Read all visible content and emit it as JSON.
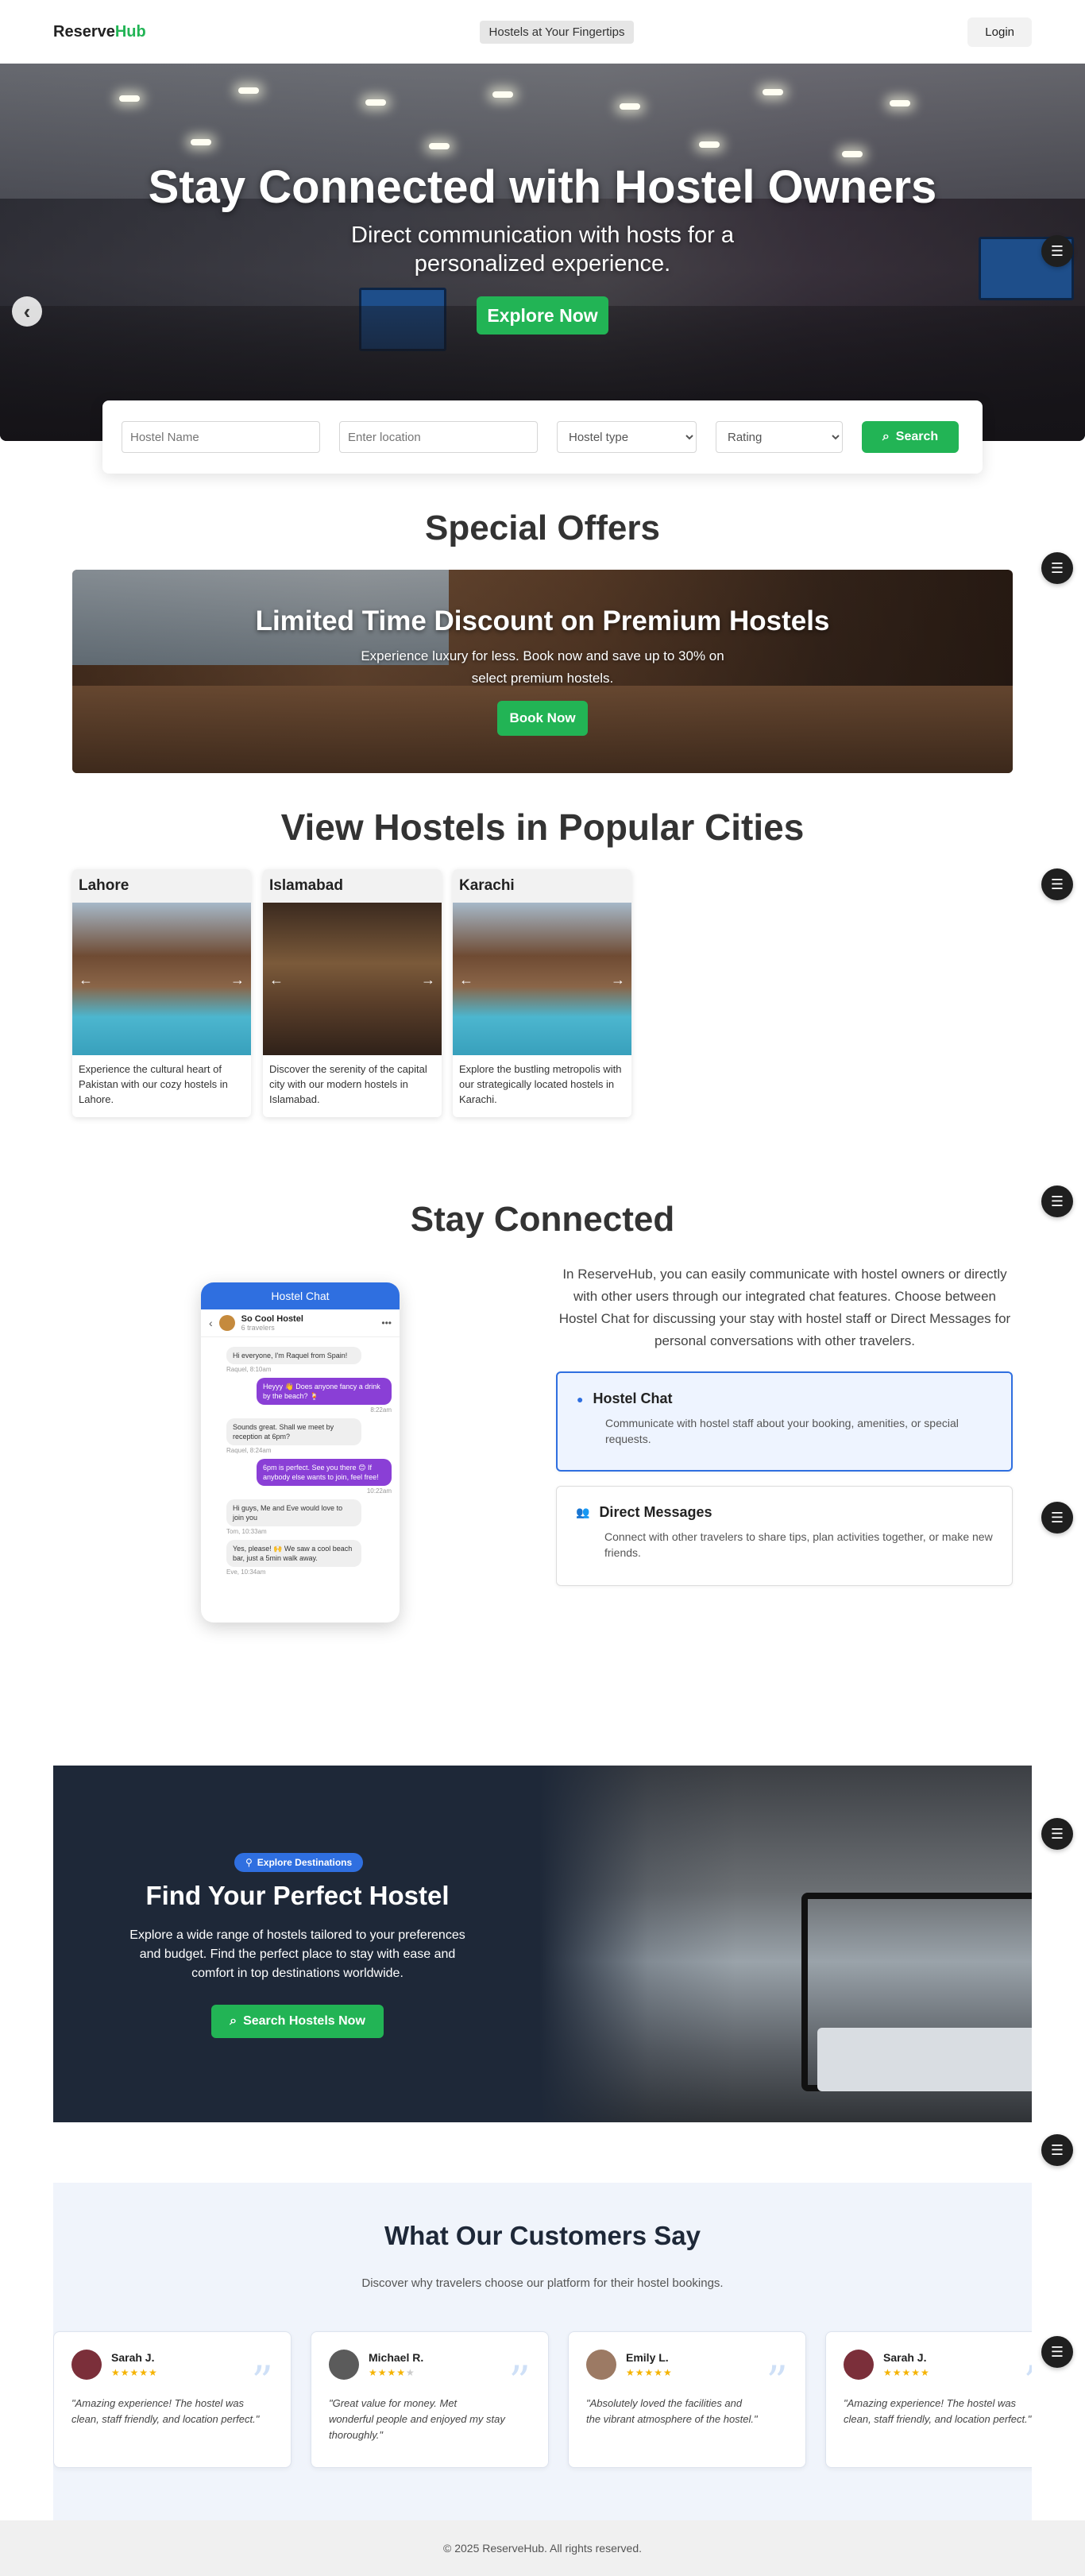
{
  "nav": {
    "brand_primary": "Reserve",
    "brand_accent": "Hub",
    "tagline": "Hostels at Your Fingertips",
    "login": "Login"
  },
  "hero": {
    "title": "Stay Connected with Hostel Owners",
    "subtitle": "Direct communication with hosts for a personalized experience.",
    "cta": "Explore Now",
    "prev_icon": "chevron-left-icon"
  },
  "search": {
    "name_placeholder": "Hostel Name",
    "location_placeholder": "Enter location",
    "type_selected": "Hostel type",
    "rating_selected": "Rating",
    "button": "Search"
  },
  "offers": {
    "section_title": "Special Offers",
    "title": "Limited Time Discount on Premium Hostels",
    "text": "Experience luxury for less. Book now and save up to 30% on select premium hostels.",
    "cta": "Book Now"
  },
  "cities": {
    "section_title": "View Hostels in Popular Cities",
    "items": [
      {
        "name": "Lahore",
        "desc": "Experience the cultural heart of Pakistan with our cozy hostels in Lahore."
      },
      {
        "name": "Islamabad",
        "desc": "Discover the serenity of the capital city with our modern hostels in Islamabad."
      },
      {
        "name": "Karachi",
        "desc": "Explore the bustling metropolis with our strategically located hostels in Karachi."
      }
    ]
  },
  "connected": {
    "section_title": "Stay Connected",
    "text": "In ReserveHub, you can easily communicate with hostel owners or directly with other users through our integrated chat features. Choose between Hostel Chat for discussing your stay with hostel staff or Direct Messages for personal conversations with other travelers.",
    "phone": {
      "header": "Hostel Chat",
      "chat_name": "So Cool Hostel",
      "chat_meta": "6 travelers",
      "messages": [
        {
          "text": "Hi everyone, I'm Raquel from Spain!",
          "meta": "Raquel, 8:10am"
        },
        {
          "text": "Heyyy 👋 Does anyone fancy a drink by the beach? 🍹",
          "meta": "8:22am"
        },
        {
          "text": "Sounds great. Shall we meet by reception at 6pm?",
          "meta": "Raquel, 8:24am"
        },
        {
          "text": "6pm is perfect. See you there 😊 If anybody else wants to join, feel free!",
          "meta": "10:22am"
        },
        {
          "text": "Hi guys, Me and Eve would love to join you",
          "meta": "Tom, 10:33am"
        },
        {
          "text": "Yes, please! 🙌 We saw a cool beach bar, just a 5min walk away.",
          "meta": "Eve, 10:34am"
        }
      ]
    },
    "options": [
      {
        "title": "Hostel Chat",
        "desc": "Communicate with hostel staff about your booking, amenities, or special requests."
      },
      {
        "title": "Direct Messages",
        "desc": "Connect with other travelers to share tips, plan activities together, or make new friends."
      }
    ]
  },
  "find": {
    "badge": "Explore Destinations",
    "title": "Find Your Perfect Hostel",
    "text": "Explore a wide range of hostels tailored to your preferences and budget. Find the perfect place to stay with ease and comfort in top destinations worldwide.",
    "cta": "Search Hostels Now"
  },
  "testimonials": {
    "title": "What Our Customers Say",
    "subtitle": "Discover why travelers choose our platform for their hostel bookings.",
    "items": [
      {
        "name": "Sarah J.",
        "rating": 5,
        "quote": "\"Amazing experience! The hostel was clean, staff friendly, and location perfect.\""
      },
      {
        "name": "Michael R.",
        "rating": 4,
        "quote": "\"Great value for money. Met wonderful people and enjoyed my stay thoroughly.\""
      },
      {
        "name": "Emily L.",
        "rating": 5,
        "quote": "\"Absolutely loved the facilities and the vibrant atmosphere of the hostel.\""
      },
      {
        "name": "Sarah J.",
        "rating": 5,
        "quote": "\"Amazing experience! The hostel was clean, staff friendly, and location perfect.\""
      }
    ]
  },
  "footer": {
    "text": "© 2025 ReserveHub. All rights reserved."
  },
  "colors": {
    "accent_green": "#22b455",
    "accent_blue": "#2f6fe0",
    "chat_purple": "#8a3fd6",
    "dark_panel": "#1e2838"
  }
}
